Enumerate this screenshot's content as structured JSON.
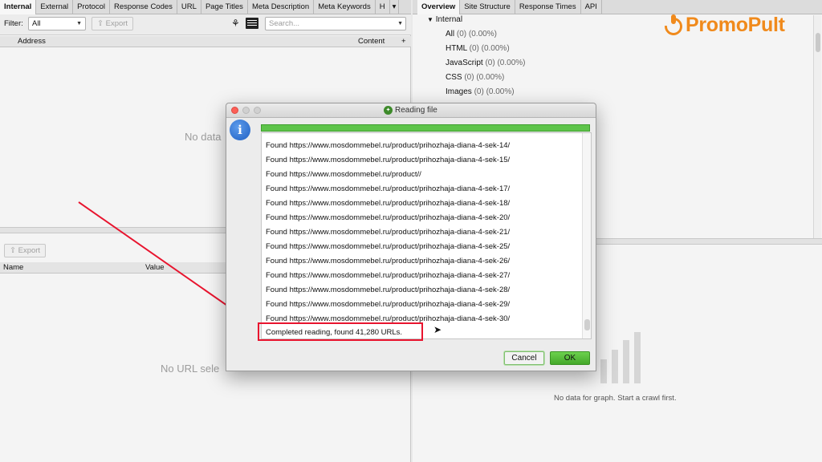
{
  "left_tabs": [
    "Internal",
    "External",
    "Protocol",
    "Response Codes",
    "URL",
    "Page Titles",
    "Meta Description",
    "Meta Keywords",
    "H"
  ],
  "filter": {
    "label": "Filter:",
    "selected": "All"
  },
  "export_label": "Export",
  "search_placeholder": "Search...",
  "top_table": {
    "col_address": "Address",
    "col_content": "Content",
    "empty_text": "No data"
  },
  "bottom_panel": {
    "export_label": "Export",
    "col_name": "Name",
    "col_value": "Value",
    "empty_text": "No URL sele"
  },
  "right_tabs": [
    "Overview",
    "Site Structure",
    "Response Times",
    "API"
  ],
  "tree": {
    "group": "Internal",
    "items": [
      {
        "label": "All",
        "stat": "(0) (0.00%)"
      },
      {
        "label": "HTML",
        "stat": "(0) (0.00%)"
      },
      {
        "label": "JavaScript",
        "stat": "(0) (0.00%)"
      },
      {
        "label": "CSS",
        "stat": "(0) (0.00%)"
      },
      {
        "label": "Images",
        "stat": "(0) (0.00%)"
      }
    ]
  },
  "graph_empty_text": "No data for graph. Start a crawl first.",
  "brand": "PromoPult",
  "dialog": {
    "title": "Reading file",
    "progress": 1.0,
    "log_lines": [
      "Found https://www.mosdommebel.ru/product/prihozhaja-diana-4-sek-14/",
      "Found https://www.mosdommebel.ru/product/prihozhaja-diana-4-sek-15/",
      "Found https://www.mosdommebel.ru/product//",
      "Found https://www.mosdommebel.ru/product/prihozhaja-diana-4-sek-17/",
      "Found https://www.mosdommebel.ru/product/prihozhaja-diana-4-sek-18/",
      "Found https://www.mosdommebel.ru/product/prihozhaja-diana-4-sek-20/",
      "Found https://www.mosdommebel.ru/product/prihozhaja-diana-4-sek-21/",
      "Found https://www.mosdommebel.ru/product/prihozhaja-diana-4-sek-25/",
      "Found https://www.mosdommebel.ru/product/prihozhaja-diana-4-sek-26/",
      "Found https://www.mosdommebel.ru/product/prihozhaja-diana-4-sek-27/",
      "Found https://www.mosdommebel.ru/product/prihozhaja-diana-4-sek-28/",
      "Found https://www.mosdommebel.ru/product/prihozhaja-diana-4-sek-29/",
      "Found https://www.mosdommebel.ru/product/prihozhaja-diana-4-sek-30/"
    ],
    "completed": "Completed reading, found 41,280 URLs.",
    "cancel_label": "Cancel",
    "ok_label": "OK"
  },
  "colors": {
    "accent_green": "#5ec44a",
    "annotation_red": "#e8142e",
    "brand_orange": "#f08a1c"
  }
}
